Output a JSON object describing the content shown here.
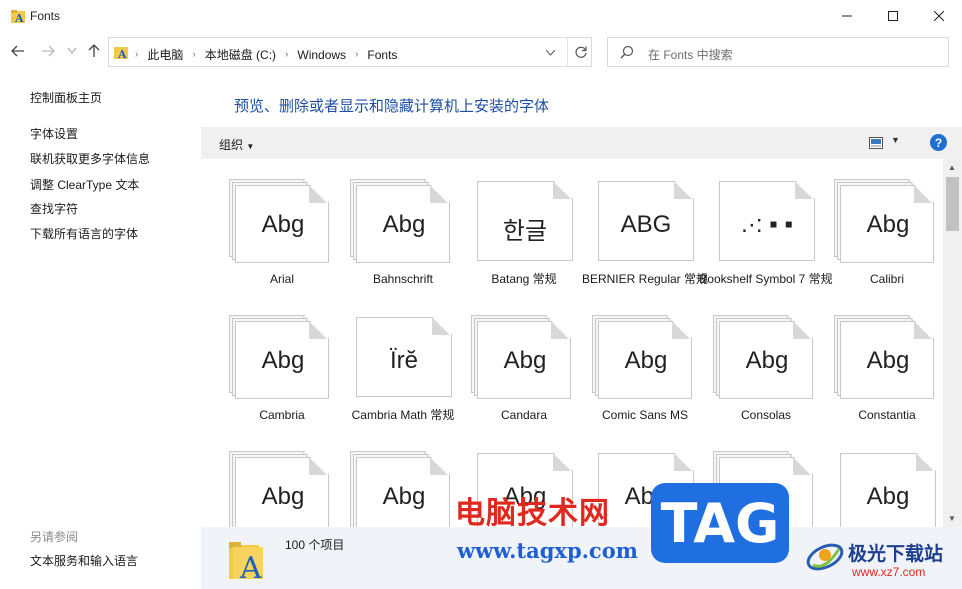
{
  "window": {
    "title": "Fonts"
  },
  "address": {
    "crumbs": [
      "此电脑",
      "本地磁盘 (C:)",
      "Windows",
      "Fonts"
    ]
  },
  "search": {
    "placeholder": "在 Fonts 中搜索"
  },
  "left_pane": {
    "home": "控制面板主页",
    "links": [
      "字体设置",
      "联机获取更多字体信息",
      "调整 ClearType 文本",
      "查找字符",
      "下载所有语言的字体"
    ],
    "see_also": "另请参阅",
    "see_also_links": [
      "文本服务和输入语言"
    ]
  },
  "main": {
    "title": "预览、删除或者显示和隐藏计算机上安装的字体",
    "organize": "组织",
    "help": "?"
  },
  "fonts": [
    {
      "name": "Arial",
      "sample": "Abg",
      "stack": true
    },
    {
      "name": "Bahnschrift",
      "sample": "Abg",
      "stack": true
    },
    {
      "name": "Batang 常规",
      "sample": "한글",
      "stack": false
    },
    {
      "name": "BERNIER Regular 常规",
      "sample": "ABG",
      "stack": false
    },
    {
      "name": "Bookshelf Symbol 7 常规",
      "sample": ".·:  ▪  ▪",
      "stack": false
    },
    {
      "name": "Calibri",
      "sample": "Abg",
      "stack": true
    },
    {
      "name": "Cambria",
      "sample": "Abg",
      "stack": true
    },
    {
      "name": "Cambria Math 常规",
      "sample": "Ïrĕ",
      "stack": false
    },
    {
      "name": "Candara",
      "sample": "Abg",
      "stack": true
    },
    {
      "name": "Comic Sans MS",
      "sample": "Abg",
      "stack": true
    },
    {
      "name": "Consolas",
      "sample": "Abg",
      "stack": true
    },
    {
      "name": "Constantia",
      "sample": "Abg",
      "stack": true
    },
    {
      "name": "",
      "sample": "Abg",
      "stack": true
    },
    {
      "name": "",
      "sample": "Abg",
      "stack": true
    },
    {
      "name": "",
      "sample": "Abg",
      "stack": false
    },
    {
      "name": "",
      "sample": "Abg",
      "stack": false
    },
    {
      "name": "",
      "sample": "Abg",
      "stack": true
    },
    {
      "name": "",
      "sample": "Abg",
      "stack": false
    }
  ],
  "details": {
    "count": "100 个项目"
  },
  "watermark": {
    "site_cn": "电脑技术网",
    "site_url": "www.tagxp.com",
    "tag": "TAG",
    "jg_name": "极光下载站",
    "jg_url": "www.xz7.com"
  },
  "colors": {
    "accent": "#1e4fa3",
    "help": "#1f6fd1",
    "details_bg": "#f0f4f9",
    "cmdbar_bg": "#f0f0f0"
  }
}
